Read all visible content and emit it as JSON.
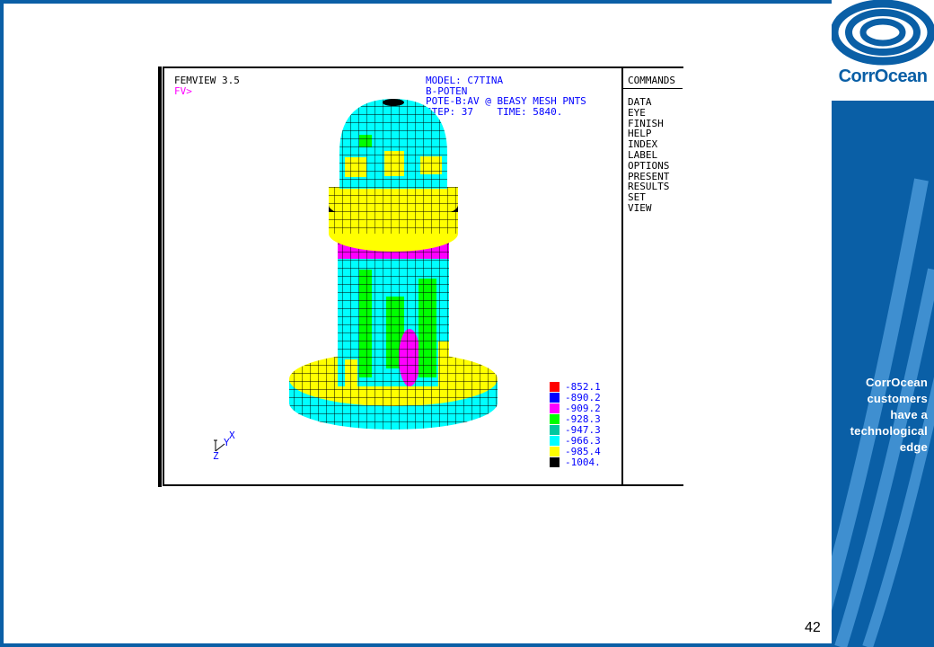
{
  "app": {
    "title": "FEMVIEW 3.5",
    "prompt": "FV>"
  },
  "model_info": {
    "lines": [
      "MODEL: C7TINA",
      "B-POTEN",
      "POTE-B:AV @ BEASY MESH PNTS",
      "STEP: 37    TIME: 5840."
    ]
  },
  "commands": {
    "title": "COMMANDS",
    "items": [
      "DATA",
      "EYE",
      "FINISH",
      "HELP",
      "INDEX",
      "LABEL",
      "OPTIONS",
      "PRESENT",
      "RESULTS",
      "SET",
      "VIEW"
    ]
  },
  "legend": {
    "entries": [
      {
        "value": "-852.1",
        "color": "#ff0000"
      },
      {
        "value": "-890.2",
        "color": "#0000ff"
      },
      {
        "value": "-909.2",
        "color": "#ff00ff"
      },
      {
        "value": "-928.3",
        "color": "#00ff00"
      },
      {
        "value": "-947.3",
        "color": "#00c8a0"
      },
      {
        "value": "-966.3",
        "color": "#00ffff"
      },
      {
        "value": "-985.4",
        "color": "#ffff00"
      },
      {
        "value": "-1004.",
        "color": "#000000"
      }
    ]
  },
  "axis": {
    "x": "X",
    "y": "Y",
    "z": "Z"
  },
  "brand": {
    "name": "CorrOcean",
    "tagline": [
      "CorrOcean",
      "customers",
      "have a",
      "technological",
      "edge"
    ],
    "color": "#0a5fa6"
  },
  "slide": {
    "page_number": "42"
  }
}
